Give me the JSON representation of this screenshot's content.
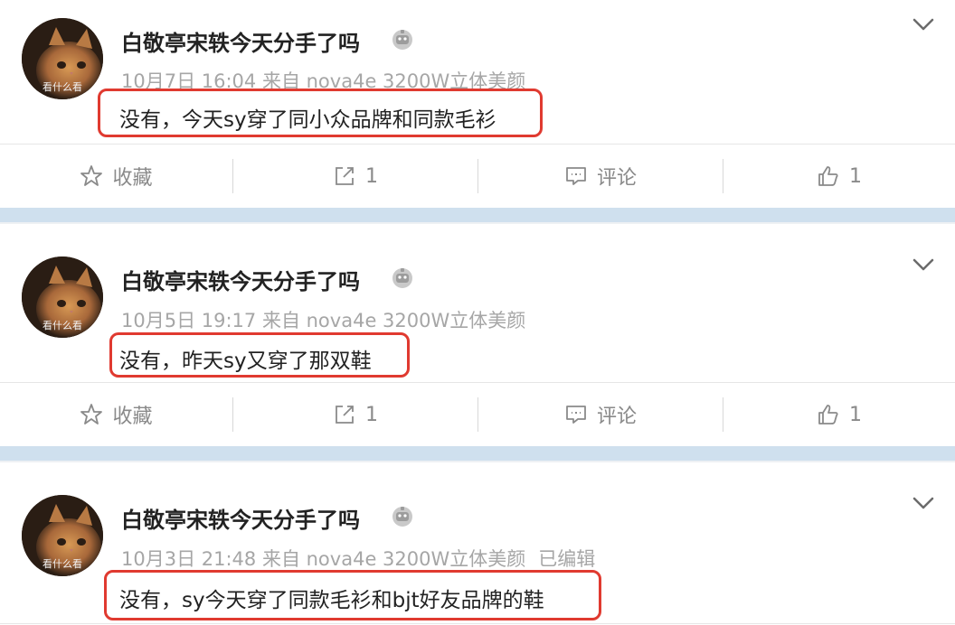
{
  "posts": [
    {
      "username": "白敬亭宋轶今天分手了吗",
      "meta": "10月7日 16:04 来自 nova4e 3200W立体美颜",
      "edited": "",
      "content": "没有，今天sy穿了同小众品牌和同款毛衫",
      "avatar_caption": "看什么看",
      "actions": {
        "favorite": "收藏",
        "repost": "1",
        "comment": "评论",
        "like": "1"
      }
    },
    {
      "username": "白敬亭宋轶今天分手了吗",
      "meta": "10月5日 19:17 来自 nova4e 3200W立体美颜",
      "edited": "",
      "content": "没有，昨天sy又穿了那双鞋",
      "avatar_caption": "看什么看",
      "actions": {
        "favorite": "收藏",
        "repost": "1",
        "comment": "评论",
        "like": "1"
      }
    },
    {
      "username": "白敬亭宋轶今天分手了吗",
      "meta": "10月3日 21:48 来自 nova4e 3200W立体美颜",
      "edited": "已编辑",
      "content": "没有，sy今天穿了同款毛衫和bjt好友品牌的鞋",
      "avatar_caption": "看什么看"
    }
  ],
  "icons": {
    "vip": "crown-badge-icon",
    "chevron": "chevron-down-icon",
    "favorite": "star-icon",
    "repost": "share-icon",
    "comment": "comment-icon",
    "like": "thumbs-up-icon"
  },
  "colors": {
    "highlight": "#e03a30",
    "separator": "#cfe0ee",
    "secondary_text": "#a6a6a6"
  }
}
